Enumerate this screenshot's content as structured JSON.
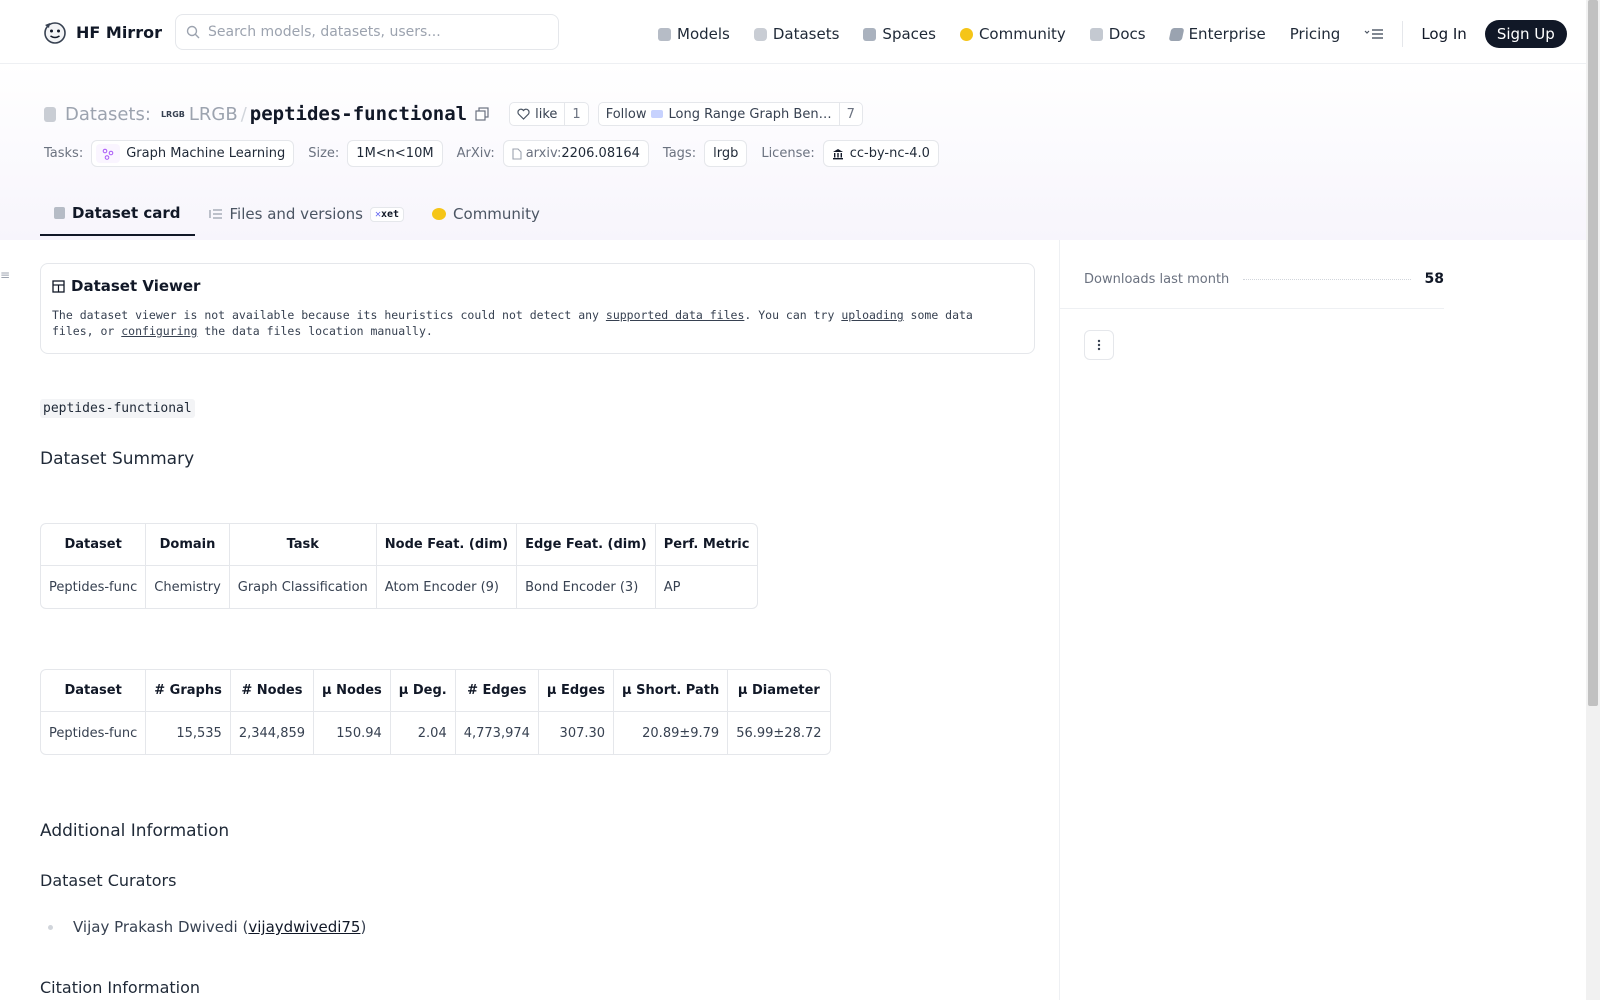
{
  "nav": {
    "brand": "HF Mirror",
    "search_placeholder": "Search models, datasets, users...",
    "links": [
      {
        "label": "Models",
        "icon": "models-icon",
        "color": "#b6bcc6"
      },
      {
        "label": "Datasets",
        "icon": "datasets-icon",
        "color": "#c9cdd4"
      },
      {
        "label": "Spaces",
        "icon": "spaces-icon",
        "color": "#aab2be"
      },
      {
        "label": "Community",
        "icon": "community-icon",
        "color": "#f5c518"
      },
      {
        "label": "Docs",
        "icon": "docs-icon",
        "color": "#c4c9d1"
      },
      {
        "label": "Enterprise",
        "icon": "enterprise-icon",
        "color": "#9aa3b0"
      },
      {
        "label": "Pricing",
        "icon": "",
        "color": ""
      }
    ],
    "login": "Log In",
    "signup": "Sign Up"
  },
  "repo": {
    "kind": "Datasets:",
    "org_badge": "LRGB",
    "org": "LRGB",
    "name": "peptides-functional",
    "like_label": "like",
    "like_count": "1",
    "follow_label": "Follow",
    "follow_org": "Long Range Graph Ben…",
    "follow_count": "7"
  },
  "meta": {
    "tasks_label": "Tasks:",
    "task": "Graph Machine Learning",
    "size_label": "Size:",
    "size": "1M<n<10M",
    "arxiv_label": "ArXiv:",
    "arxiv_prefix": "arxiv:",
    "arxiv_id": "2206.08164",
    "tags_label": "Tags:",
    "tag": "lrgb",
    "license_label": "License:",
    "license": "cc-by-nc-4.0"
  },
  "tabs": [
    {
      "label": "Dataset card",
      "active": true
    },
    {
      "label": "Files and versions",
      "badge": "xet"
    },
    {
      "label": "Community"
    }
  ],
  "viewer": {
    "title": "Dataset Viewer",
    "text_1": "The dataset viewer is not available because its heuristics could not detect any ",
    "link_1": "supported data files",
    "text_2": ". You can try ",
    "link_2": "uploading",
    "text_3": " some data files, or ",
    "link_3": "configuring",
    "text_4": " the data files location manually."
  },
  "card": {
    "code_name": "peptides-functional",
    "summary_heading": "Dataset Summary",
    "table1": {
      "headers": [
        "Dataset",
        "Domain",
        "Task",
        "Node Feat. (dim)",
        "Edge Feat. (dim)",
        "Perf. Metric"
      ],
      "rows": [
        [
          "Peptides-func",
          "Chemistry",
          "Graph Classification",
          "Atom Encoder (9)",
          "Bond Encoder (3)",
          "AP"
        ]
      ]
    },
    "table2": {
      "headers": [
        "Dataset",
        "# Graphs",
        "# Nodes",
        "µ Nodes",
        "µ Deg.",
        "# Edges",
        "µ Edges",
        "µ Short. Path",
        "µ Diameter"
      ],
      "rows": [
        [
          "Peptides-func",
          "15,535",
          "2,344,859",
          "150.94",
          "2.04",
          "4,773,974",
          "307.30",
          "20.89±9.79",
          "56.99±28.72"
        ]
      ]
    },
    "additional_heading": "Additional Information",
    "curators_heading": "Dataset Curators",
    "curator_name": "Vijay Prakash Dwivedi (",
    "curator_handle": "vijaydwivedi75",
    "curator_close": ")",
    "citation_heading": "Citation Information"
  },
  "sidebar": {
    "downloads_label": "Downloads last month",
    "downloads_value": "58"
  }
}
